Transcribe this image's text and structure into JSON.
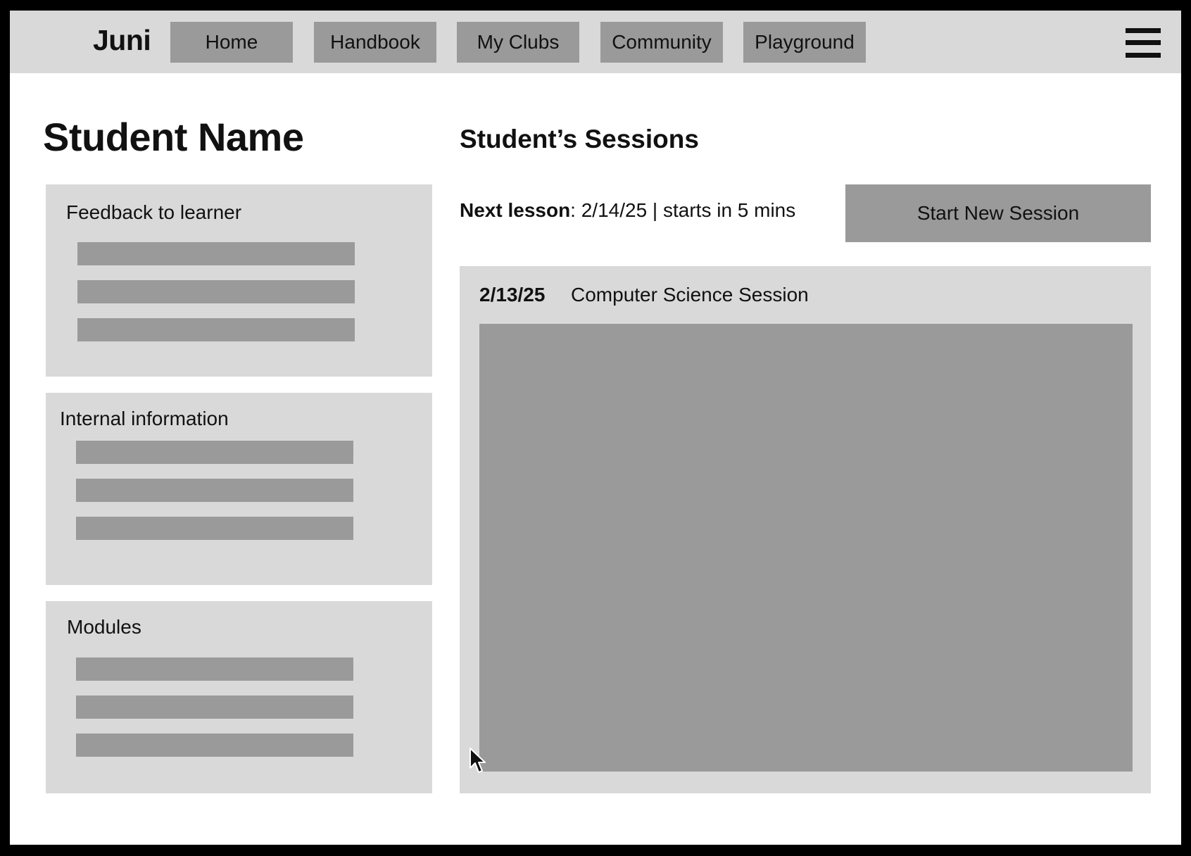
{
  "app": {
    "logo": "Juni"
  },
  "nav": {
    "items": [
      {
        "label": "Home"
      },
      {
        "label": "Handbook"
      },
      {
        "label": "My Clubs"
      },
      {
        "label": "Community"
      },
      {
        "label": "Playground"
      }
    ],
    "menu_icon": "hamburger-menu-icon"
  },
  "student": {
    "name": "Student Name"
  },
  "panels": [
    {
      "title": "Feedback to learner"
    },
    {
      "title": "Internal information"
    },
    {
      "title": "Modules"
    }
  ],
  "sessions": {
    "title": "Student’s Sessions",
    "next_lesson_label": "Next lesson",
    "next_lesson_detail": ": 2/14/25 | starts in 5 mins",
    "start_button": "Start New Session",
    "items": [
      {
        "date": "2/13/25",
        "name": "Computer Science Session"
      }
    ]
  },
  "colors": {
    "frame": "#000000",
    "background": "#ffffff",
    "panel": "#d9d9d9",
    "placeholder": "#9a9a9a",
    "text": "#111111"
  }
}
